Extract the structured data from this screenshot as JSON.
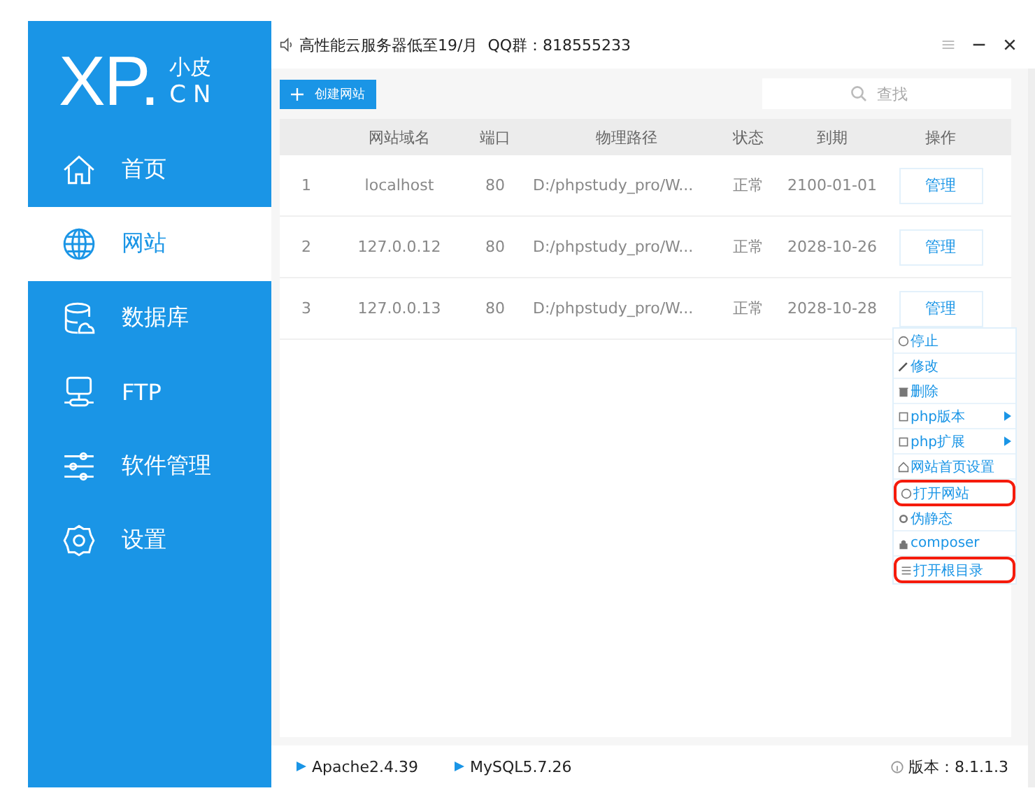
{
  "logo": {
    "mark": "XP.",
    "line1": "小皮",
    "line2": "CN"
  },
  "sidebar": {
    "items": [
      {
        "label": "首页",
        "selected": false
      },
      {
        "label": "网站",
        "selected": true
      },
      {
        "label": "数据库",
        "selected": false
      },
      {
        "label": "FTP",
        "selected": false
      },
      {
        "label": "软件管理",
        "selected": false
      },
      {
        "label": "设置",
        "selected": false
      }
    ]
  },
  "topbar": {
    "notice": "高性能云服务器低至19/月  QQ群：818555233"
  },
  "toolbar": {
    "create_button": "创建网站",
    "search": {
      "placeholder": "查找"
    }
  },
  "table": {
    "columns": [
      "",
      "网站域名",
      "端口",
      "物理路径",
      "状态",
      "到期",
      "操作"
    ],
    "rows": [
      {
        "cells": [
          "1",
          "localhost",
          "80",
          "D:/phpstudy_pro/W...",
          "正常",
          "2100-01-01"
        ],
        "action": "管理"
      },
      {
        "cells": [
          "2",
          "127.0.0.12",
          "80",
          "D:/phpstudy_pro/W...",
          "正常",
          "2028-10-26"
        ],
        "action": "管理"
      },
      {
        "cells": [
          "3",
          "127.0.0.13",
          "80",
          "D:/phpstudy_pro/W...",
          "正常",
          "2028-10-28"
        ],
        "action": "管理"
      }
    ]
  },
  "context_menu": {
    "items": [
      {
        "label": "停止",
        "submenu": false,
        "highlighted": false
      },
      {
        "label": "修改",
        "submenu": false,
        "highlighted": false
      },
      {
        "label": "删除",
        "submenu": false,
        "highlighted": false
      },
      {
        "label": "php版本",
        "submenu": true,
        "highlighted": false
      },
      {
        "label": "php扩展",
        "submenu": true,
        "highlighted": false
      },
      {
        "label": "网站首页设置",
        "submenu": false,
        "highlighted": false
      },
      {
        "label": "打开网站",
        "submenu": false,
        "highlighted": true
      },
      {
        "label": "伪静态",
        "submenu": false,
        "highlighted": false
      },
      {
        "label": "composer",
        "submenu": false,
        "highlighted": false
      },
      {
        "label": "打开根目录",
        "submenu": false,
        "highlighted": true
      }
    ]
  },
  "status_bar": {
    "services": [
      "Apache2.4.39",
      "MySQL5.7.26"
    ],
    "version": "版本：8.1.1.3"
  }
}
